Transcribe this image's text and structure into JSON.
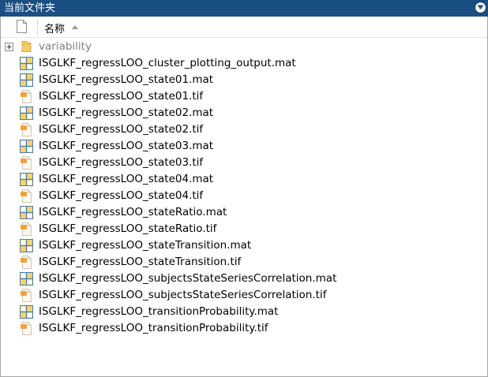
{
  "title": "当前文件夹",
  "header": {
    "name_label": "名称"
  },
  "folder": {
    "name": "variability",
    "icon": "folder-icon",
    "expanded": false
  },
  "files": [
    {
      "name": "ISGLKF_regressLOO_cluster_plotting_output.mat",
      "type": "mat"
    },
    {
      "name": "ISGLKF_regressLOO_state01.mat",
      "type": "mat"
    },
    {
      "name": "ISGLKF_regressLOO_state01.tif",
      "type": "tif"
    },
    {
      "name": "ISGLKF_regressLOO_state02.mat",
      "type": "mat"
    },
    {
      "name": "ISGLKF_regressLOO_state02.tif",
      "type": "tif"
    },
    {
      "name": "ISGLKF_regressLOO_state03.mat",
      "type": "mat"
    },
    {
      "name": "ISGLKF_regressLOO_state03.tif",
      "type": "tif"
    },
    {
      "name": "ISGLKF_regressLOO_state04.mat",
      "type": "mat"
    },
    {
      "name": "ISGLKF_regressLOO_state04.tif",
      "type": "tif"
    },
    {
      "name": "ISGLKF_regressLOO_stateRatio.mat",
      "type": "mat"
    },
    {
      "name": "ISGLKF_regressLOO_stateRatio.tif",
      "type": "tif"
    },
    {
      "name": "ISGLKF_regressLOO_stateTransition.mat",
      "type": "mat"
    },
    {
      "name": "ISGLKF_regressLOO_stateTransition.tif",
      "type": "tif"
    },
    {
      "name": "ISGLKF_regressLOO_subjectsStateSeriesCorrelation.mat",
      "type": "mat"
    },
    {
      "name": "ISGLKF_regressLOO_subjectsStateSeriesCorrelation.tif",
      "type": "tif"
    },
    {
      "name": "ISGLKF_regressLOO_transitionProbability.mat",
      "type": "mat"
    },
    {
      "name": "ISGLKF_regressLOO_transitionProbability.tif",
      "type": "tif"
    }
  ],
  "colors": {
    "titlebar": "#1a4f84",
    "folder_text": "#808080",
    "mat_icon_grid": "#4a7bb4",
    "mat_icon_fill": "#f6d36b",
    "folder_icon": "#f3cf6a"
  }
}
